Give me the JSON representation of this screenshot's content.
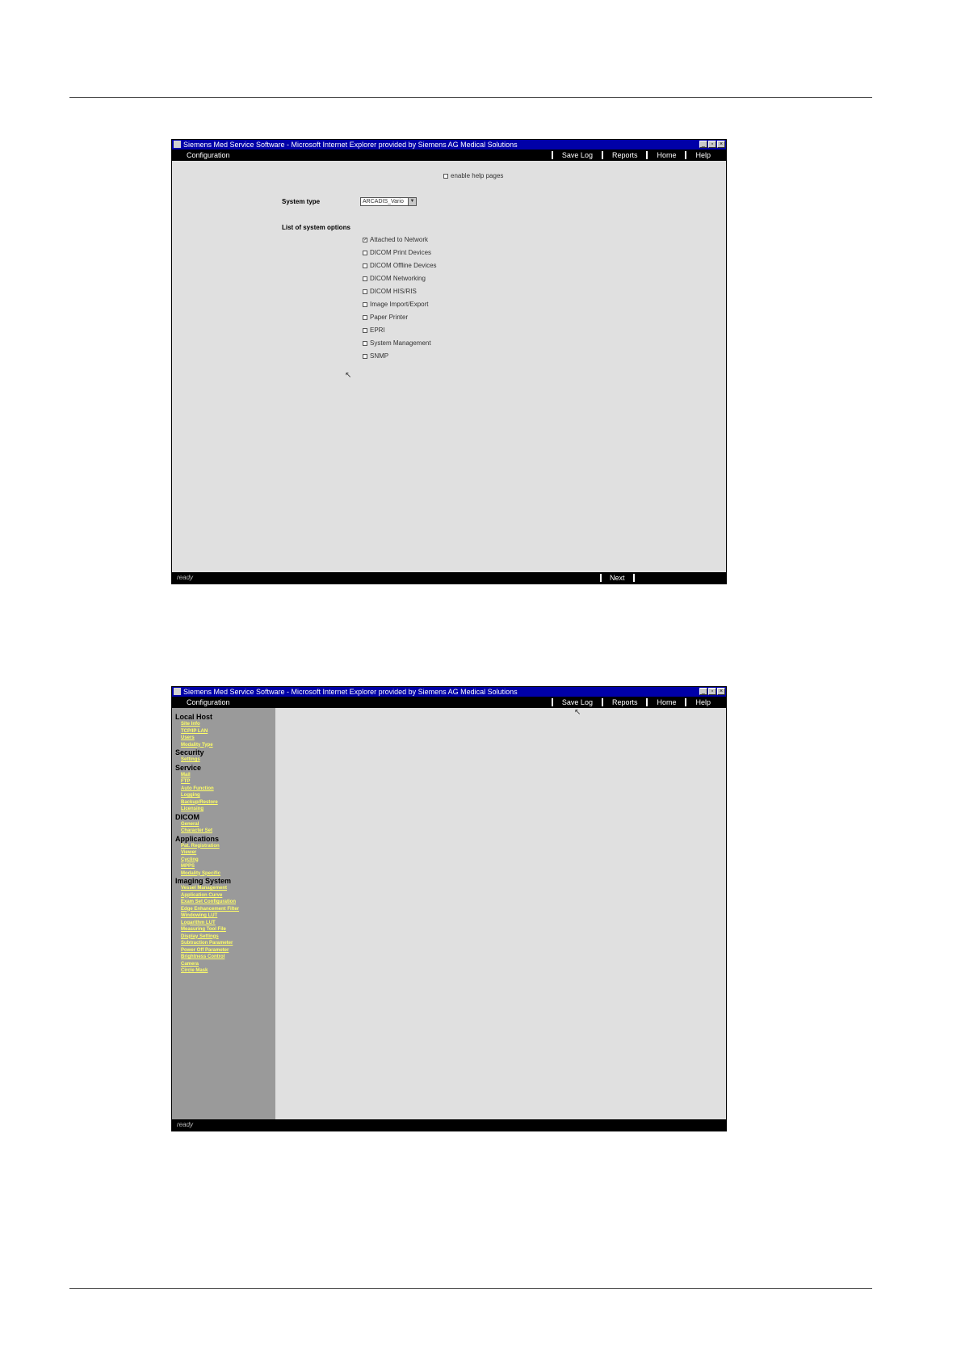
{
  "window": {
    "title": "Siemens Med Service Software - Microsoft Internet Explorer provided by Siemens AG Medical Solutions",
    "context": "Configuration",
    "menus": [
      "Save Log",
      "Reports",
      "Home",
      "Help"
    ],
    "status": "ready"
  },
  "screen1": {
    "enable_help": "enable help pages",
    "system_type_label": "System type",
    "system_type_value": "ARCADIS_Vario",
    "options_label": "List of system options",
    "options": [
      {
        "label": "Attached to Network",
        "checked": true
      },
      {
        "label": "DICOM Print Devices",
        "checked": false
      },
      {
        "label": "DICOM Offline Devices",
        "checked": false
      },
      {
        "label": "DICOM Networking",
        "checked": false
      },
      {
        "label": "DICOM HIS/RIS",
        "checked": false
      },
      {
        "label": "Image Import/Export",
        "checked": false
      },
      {
        "label": "Paper Printer",
        "checked": false
      },
      {
        "label": "EPRI",
        "checked": false
      },
      {
        "label": "System Management",
        "checked": false
      },
      {
        "label": "SNMP",
        "checked": false
      }
    ],
    "next_label": "Next"
  },
  "screen2": {
    "nav": [
      {
        "section": "Local Host",
        "links": [
          "Site Info",
          "TCP/IP LAN",
          "Users",
          "Modality Type"
        ]
      },
      {
        "section": "Security",
        "links": [
          "Settings"
        ]
      },
      {
        "section": "Service",
        "links": [
          "Mail",
          "FTP",
          "Auto Function",
          "Logging",
          "Backup/Restore",
          "Licensing"
        ]
      },
      {
        "section": "DICOM",
        "links": [
          "General",
          "Character Set"
        ]
      },
      {
        "section": "Applications",
        "links": [
          "Pat. Registration",
          "Viewer",
          "Cycling",
          "MPPS",
          "Modality Specific"
        ]
      },
      {
        "section": "Imaging System",
        "links": [
          "Vessel Management",
          "Application Curve",
          "Exam Set Configuration",
          "Edge Enhancement Filter",
          "Windowing LUT",
          "Logarithm LUT",
          "Measuring Tool File",
          "Display Settings",
          "Subtraction Parameter",
          "Power Off Parameter",
          "Brightness Control",
          "Camera",
          "Circle Mask"
        ]
      }
    ]
  }
}
